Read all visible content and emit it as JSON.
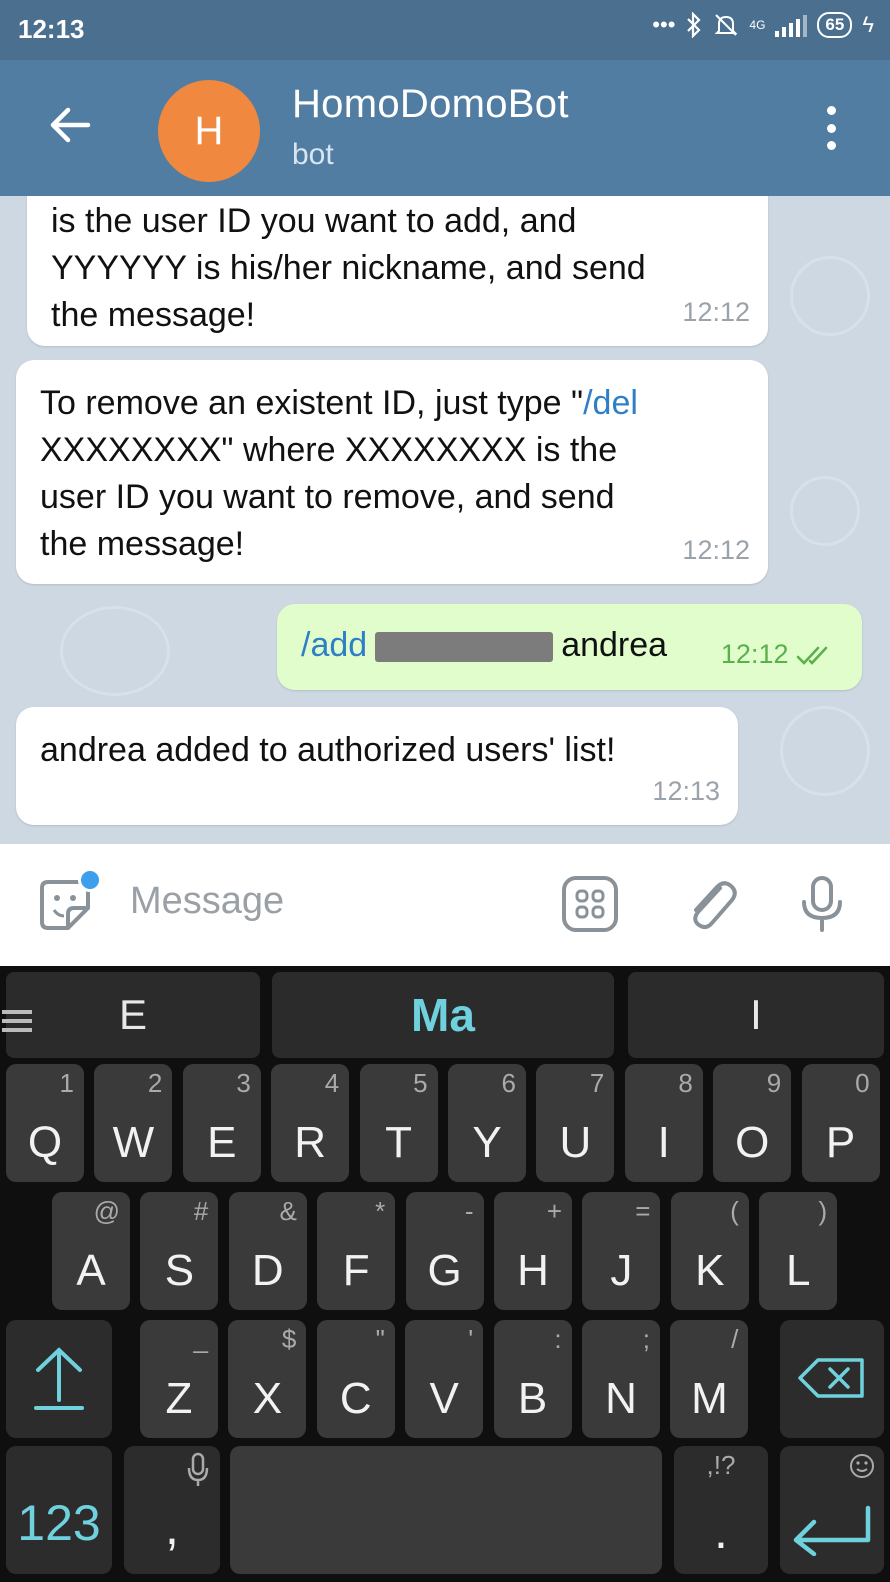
{
  "status_bar": {
    "time": "12:13",
    "network": "4G",
    "battery": "65"
  },
  "header": {
    "avatar_letter": "H",
    "title": "HomoDomoBot",
    "subtitle": "bot"
  },
  "messages": [
    {
      "lines": [
        "is the user ID you want to add, and",
        "YYYYYY is his/her nickname, and send",
        "the message!"
      ],
      "time": "12:12",
      "outgoing": false
    },
    {
      "line1_text": "To remove an existent ID, just type \"",
      "line1_link": "/del",
      "lines": [
        "XXXXXXXX\" where XXXXXXXX is the",
        "user ID you want to remove, and send",
        "the message!"
      ],
      "time": "12:12",
      "outgoing": false
    },
    {
      "command": "/add",
      "text_after": "andrea",
      "time": "12:12",
      "outgoing": true
    },
    {
      "lines": [
        "andrea added to authorized users' list!"
      ],
      "time": "12:13",
      "outgoing": false
    }
  ],
  "input": {
    "placeholder": "Message"
  },
  "keyboard": {
    "suggestions": [
      "E",
      "Ma",
      "I"
    ],
    "row1": [
      {
        "key": "Q",
        "hint": "1"
      },
      {
        "key": "W",
        "hint": "2"
      },
      {
        "key": "E",
        "hint": "3"
      },
      {
        "key": "R",
        "hint": "4"
      },
      {
        "key": "T",
        "hint": "5"
      },
      {
        "key": "Y",
        "hint": "6"
      },
      {
        "key": "U",
        "hint": "7"
      },
      {
        "key": "I",
        "hint": "8"
      },
      {
        "key": "O",
        "hint": "9"
      },
      {
        "key": "P",
        "hint": "0"
      }
    ],
    "row2": [
      {
        "key": "A",
        "hint": "@"
      },
      {
        "key": "S",
        "hint": "#"
      },
      {
        "key": "D",
        "hint": "&"
      },
      {
        "key": "F",
        "hint": "*"
      },
      {
        "key": "G",
        "hint": "-"
      },
      {
        "key": "H",
        "hint": "+"
      },
      {
        "key": "J",
        "hint": "="
      },
      {
        "key": "K",
        "hint": "("
      },
      {
        "key": "L",
        "hint": ")"
      }
    ],
    "row3": [
      {
        "key": "Z",
        "hint": "_"
      },
      {
        "key": "X",
        "hint": "$"
      },
      {
        "key": "C",
        "hint": "\""
      },
      {
        "key": "V",
        "hint": "'"
      },
      {
        "key": "B",
        "hint": ":"
      },
      {
        "key": "N",
        "hint": ";"
      },
      {
        "key": "M",
        "hint": "/"
      }
    ],
    "numbers_key": "123",
    "comma_key": ",",
    "period_key": ".",
    "period_hint": ",!?"
  },
  "colors": {
    "header": "#517da2",
    "status_bar": "#4a6f8f",
    "avatar": "#f1883f",
    "outgoing_bubble": "#e1fdcc",
    "link": "#2f7fc7",
    "keyboard_accent": "#6fd1dd"
  }
}
